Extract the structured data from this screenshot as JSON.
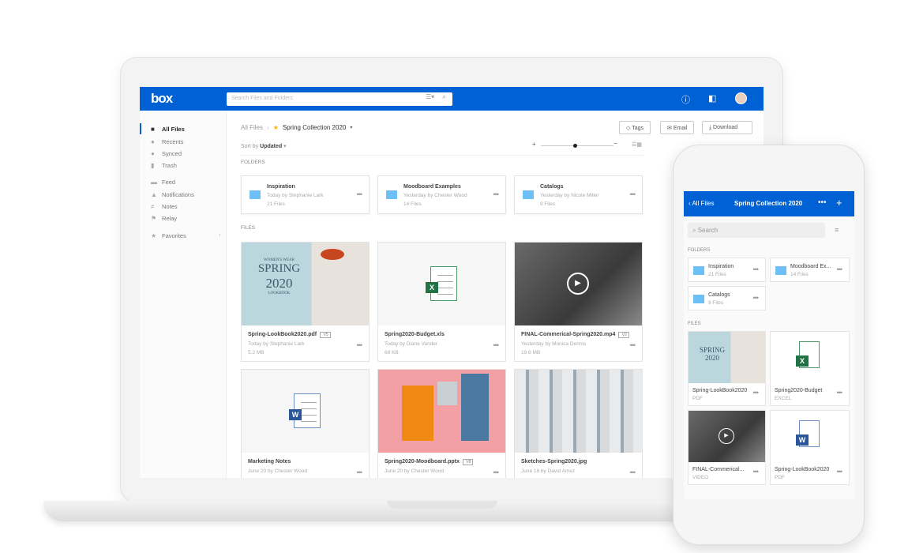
{
  "header": {
    "logo": "box",
    "search_placeholder": "Search Files and Folders"
  },
  "sidebar": {
    "items": [
      {
        "label": "All Files",
        "icon": "folder-icon",
        "active": true
      },
      {
        "label": "Recents",
        "icon": "clock-icon"
      },
      {
        "label": "Synced",
        "icon": "sync-icon"
      },
      {
        "label": "Trash",
        "icon": "trash-icon"
      },
      {
        "label": "Feed",
        "icon": "feed-icon"
      },
      {
        "label": "Notifications",
        "icon": "bell-icon"
      },
      {
        "label": "Notes",
        "icon": "notes-icon"
      },
      {
        "label": "Relay",
        "icon": "flag-icon"
      },
      {
        "label": "Favorites",
        "icon": "star-icon"
      }
    ]
  },
  "breadcrumb": {
    "root": "All Files",
    "current": "Spring Collection 2020"
  },
  "toolbar": {
    "tags": "Tags",
    "email": "Email",
    "download": "Download",
    "sort_prefix": "Sort by",
    "sort_value": "Updated"
  },
  "sections": {
    "folders": "FOLDERS",
    "files": "FILES"
  },
  "folders": [
    {
      "name": "Inspiration",
      "meta": "Today by Stephanie Lark",
      "count": "21 Files"
    },
    {
      "name": "Moodboard Examples",
      "meta": "Yesterday by Chester Wood",
      "count": "14 Files"
    },
    {
      "name": "Catalogs",
      "meta": "Yesterday by Nicole Miller",
      "count": "9 Files"
    }
  ],
  "files": [
    {
      "name": "Spring-LookBook2020.pdf",
      "version": "V5",
      "meta": "Today by Stephanie Lark",
      "size": "5.2 MB"
    },
    {
      "name": "Spring2020-Budget.xls",
      "meta": "Today by Diane Vander",
      "size": "68 KB"
    },
    {
      "name": "FINAL-Commerical-Spring2020.mp4",
      "version": "V2",
      "meta": "Yesterday by Monica Dennis",
      "size": "19.6 MB"
    },
    {
      "name": "Marketing Notes",
      "meta": "June 20 by Chester Wood"
    },
    {
      "name": "Spring2020-Moodboard.pptx",
      "version": "V8",
      "meta": "June 20 by Chester Wood"
    },
    {
      "name": "Sketches-Spring2020.jpg",
      "meta": "June 18 by David Amez"
    }
  ],
  "lookbook": {
    "line1": "WOMEN'S WEAR",
    "line2": "SPRING",
    "line3": "2020",
    "line4": "LOOKBOOK"
  },
  "phone": {
    "back": "All Files",
    "title": "Spring Collection 2020",
    "search_placeholder": "Search",
    "folders": [
      {
        "name": "Inspiration",
        "count": "21 Files"
      },
      {
        "name": "Moodboard Ex...",
        "count": "14 Files"
      },
      {
        "name": "Catalogs",
        "count": "9 Files"
      }
    ],
    "files": [
      {
        "name": "Spring-LookBook2020",
        "type": "PDF"
      },
      {
        "name": "Spring2020-Budget",
        "type": "EXCEL"
      },
      {
        "name": "FINAL-Commerical...",
        "type": "VIDEO"
      },
      {
        "name": "Spring-LookBook2020",
        "type": "PDF"
      }
    ]
  },
  "colors": {
    "brand": "#0061d5",
    "folder": "#6cc0f5",
    "excel": "#217346",
    "word": "#2b579a"
  }
}
